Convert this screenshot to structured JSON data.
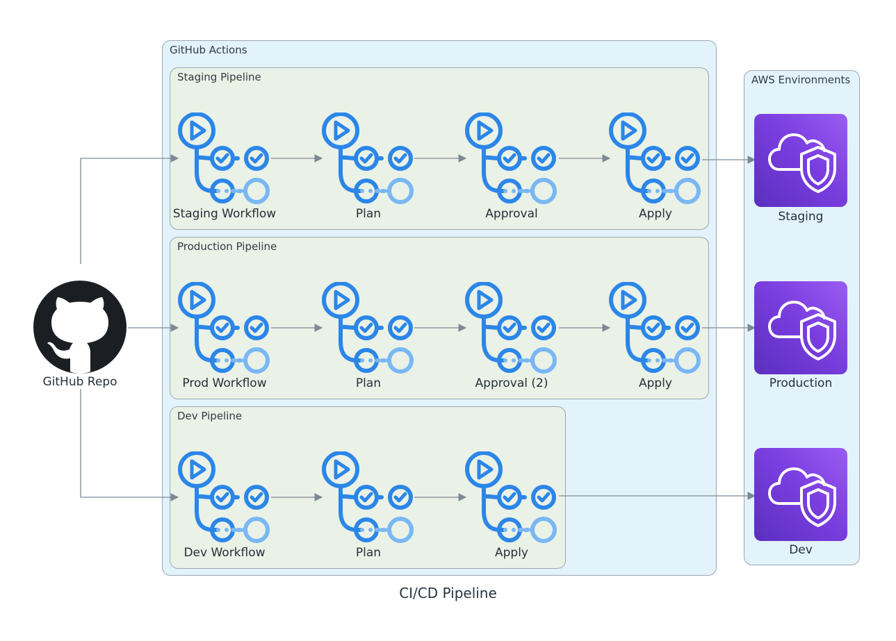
{
  "caption": "CI/CD Pipeline",
  "source": {
    "label": "GitHub Repo",
    "icon": "github-octocat-icon"
  },
  "clusters": {
    "actions": {
      "label": "GitHub Actions"
    },
    "staging": {
      "label": "Staging Pipeline",
      "steps": [
        "Staging Workflow",
        "Plan",
        "Approval",
        "Apply"
      ]
    },
    "production": {
      "label": "Production Pipeline",
      "steps": [
        "Prod Workflow",
        "Plan",
        "Approval (2)",
        "Apply"
      ]
    },
    "dev": {
      "label": "Dev Pipeline",
      "steps": [
        "Dev Workflow",
        "Plan",
        "Apply"
      ]
    },
    "aws": {
      "label": "AWS Environments",
      "targets": [
        "Staging",
        "Production",
        "Dev"
      ]
    }
  },
  "step_icon": "github-actions-workflow-icon",
  "target_icon": "aws-cloud-shield-icon",
  "colors": {
    "actions_bg": "#e3f3fb",
    "pipeline_bg": "#eaf1e6",
    "workflow_icon": "#2b86e8",
    "workflow_icon_light": "#79b7f5",
    "aws_purple": "#7b3ee0",
    "edge": "#7d8a96"
  },
  "edges": [
    {
      "from": "GitHub Repo",
      "to": "Staging Workflow"
    },
    {
      "from": "GitHub Repo",
      "to": "Prod Workflow"
    },
    {
      "from": "GitHub Repo",
      "to": "Dev Workflow"
    },
    {
      "from": "Staging Workflow",
      "to": "Plan"
    },
    {
      "from": "Plan",
      "to": "Approval"
    },
    {
      "from": "Approval",
      "to": "Apply"
    },
    {
      "from": "Apply",
      "to": "Staging"
    },
    {
      "from": "Prod Workflow",
      "to": "Plan"
    },
    {
      "from": "Plan",
      "to": "Approval (2)"
    },
    {
      "from": "Approval (2)",
      "to": "Apply"
    },
    {
      "from": "Apply",
      "to": "Production"
    },
    {
      "from": "Dev Workflow",
      "to": "Plan"
    },
    {
      "from": "Plan",
      "to": "Apply"
    },
    {
      "from": "Apply",
      "to": "Dev"
    }
  ]
}
